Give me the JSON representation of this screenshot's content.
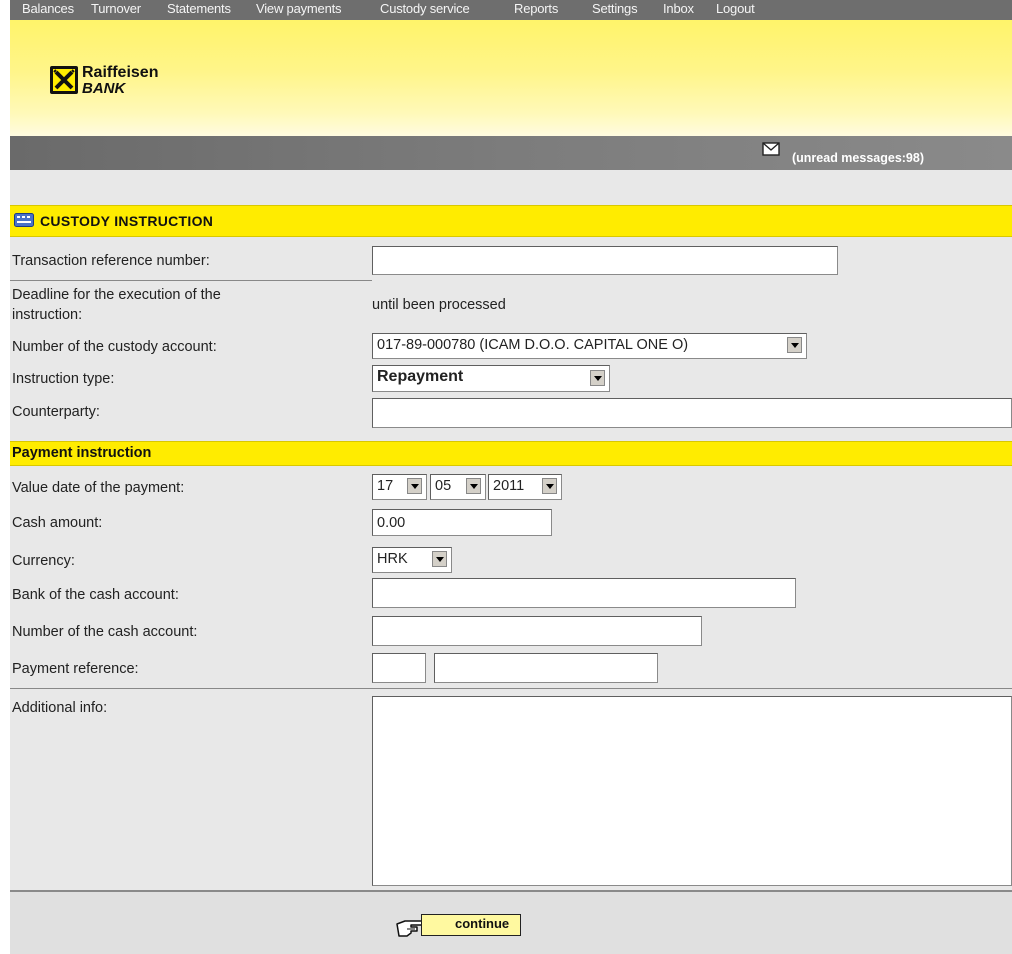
{
  "nav": {
    "items": [
      "Balances",
      "Turnover",
      "Statements",
      "View payments",
      "Custody service",
      "Reports",
      "Settings",
      "Inbox",
      "Logout"
    ]
  },
  "brand": {
    "name": "Raiffeisen",
    "sub": "BANK"
  },
  "messages": {
    "text": "(unread messages:98)"
  },
  "form": {
    "title": "CUSTODY INSTRUCTION",
    "transaction_ref": {
      "label": "Transaction reference number:",
      "value": ""
    },
    "deadline": {
      "label_line1": "Deadline for the execution of the",
      "label_line2": "instruction:",
      "value": "until been processed"
    },
    "custody_account": {
      "label": "Number of the custody account:",
      "value": "017-89-000780 (ICAM D.O.O. CAPITAL ONE O)"
    },
    "instruction_type": {
      "label": "Instruction type:",
      "value": "Repayment"
    },
    "counterparty": {
      "label": "Counterparty:",
      "value": ""
    }
  },
  "payment": {
    "title": "Payment instruction",
    "value_date": {
      "label": "Value date of the payment:",
      "day": "17",
      "month": "05",
      "year": "2011"
    },
    "cash_amount": {
      "label": "Cash amount:",
      "value": "0.00"
    },
    "currency": {
      "label": "Currency:",
      "value": "HRK"
    },
    "bank": {
      "label": "Bank of the cash account:",
      "value": ""
    },
    "cash_account": {
      "label": "Number of the cash account:",
      "value": ""
    },
    "payment_ref": {
      "label": "Payment reference:",
      "model": "",
      "number": ""
    }
  },
  "additional": {
    "label": "Additional info:",
    "value": ""
  },
  "actions": {
    "continue": "continue"
  },
  "colors": {
    "brand_yellow": "#ffec00",
    "nav_gray": "#6e6e6e"
  },
  "icons": [
    "raiffeisen-logo-icon",
    "envelope-icon",
    "keyboard-icon",
    "pointing-hand-icon"
  ]
}
